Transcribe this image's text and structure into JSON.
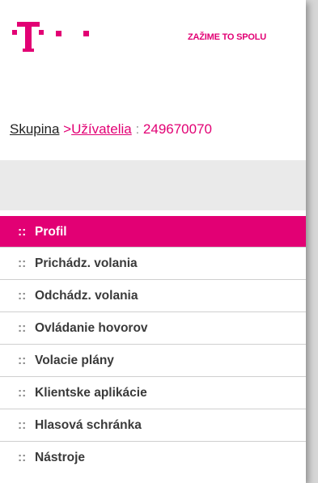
{
  "brand": {
    "logo_name": "telekom-t-logo",
    "tagline": "ZAŽIME TO SPOLU",
    "accent_color": "#e20074"
  },
  "breadcrumb": {
    "group": "Skupina",
    "separator": " >",
    "users": "Užívatelia",
    "colon": " : ",
    "id": "249670070"
  },
  "menu": {
    "bullet": "::",
    "items": [
      {
        "label": "Profil",
        "active": true
      },
      {
        "label": "Prichádz. volania",
        "active": false
      },
      {
        "label": "Odchádz. volania",
        "active": false
      },
      {
        "label": "Ovládanie hovorov",
        "active": false
      },
      {
        "label": "Volacie plány",
        "active": false
      },
      {
        "label": "Klientske aplikácie",
        "active": false
      },
      {
        "label": "Hlasová schránka",
        "active": false
      },
      {
        "label": "Nástroje",
        "active": false
      }
    ]
  }
}
